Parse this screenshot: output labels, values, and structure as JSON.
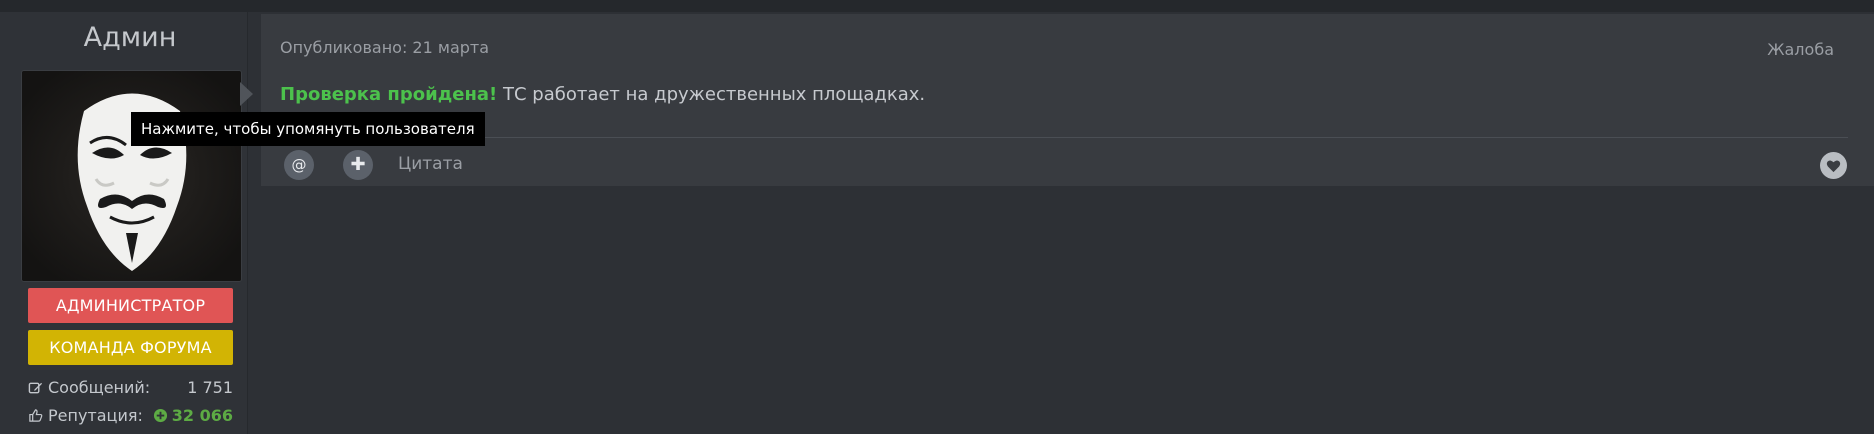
{
  "user": {
    "name": "Админ",
    "avatar_icon": "guy-fawkes-mask-icon",
    "badges": [
      {
        "label": "АДМИНИСТРАТОР",
        "color": "#e05555"
      },
      {
        "label": "КОМАНДА ФОРУМА",
        "color": "#d2b404"
      }
    ],
    "stats": {
      "messages_label": "Сообщений:",
      "messages_value": "1 751",
      "reputation_label": "Репутация:",
      "reputation_value": "32 066"
    }
  },
  "post": {
    "posted_label": "Опубликовано: 21 марта",
    "complaint_label": "Жалоба",
    "highlight": "Проверка пройдена!",
    "text": " ТС работает на дружественных площадках.",
    "highlight_color": "#4cc24c"
  },
  "actions": {
    "mention_symbol": "@",
    "plus_symbol": "✚",
    "quote_label": "Цитата",
    "like_icon": "heart-icon"
  },
  "tooltip": {
    "text": "Нажмите, чтобы упомянуть пользователя"
  }
}
